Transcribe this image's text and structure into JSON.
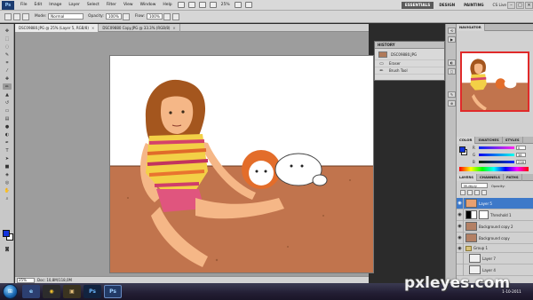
{
  "menubar": {
    "app_logo": "Ps",
    "items": [
      "File",
      "Edit",
      "Image",
      "Layer",
      "Select",
      "Filter",
      "View",
      "Window",
      "Help"
    ],
    "zoom": "25%",
    "workspaces": [
      "ESSENTIALS",
      "DESIGN",
      "PAINTING"
    ],
    "cs_live": "CS Live",
    "window_buttons": [
      "–",
      "□",
      "×"
    ]
  },
  "options": {
    "mode_label": "Mode:",
    "mode_value": "Normal",
    "opacity_label": "Opacity:",
    "opacity_value": "100%",
    "flow_label": "Flow:",
    "flow_value": "100%"
  },
  "tabs": [
    {
      "label": "DSC09880.JPG @ 25% (Layer 5, RGB/8)",
      "close": "×"
    },
    {
      "label": "DSC09880 Copy.JPG @ 33.3% (RGB/8)",
      "close": "×"
    }
  ],
  "status": {
    "zoom": "25%",
    "doc": "Doc: 10,8M/118,0M"
  },
  "history": {
    "title": "HISTORY",
    "snapshot": "DSC09880.JPG",
    "items": [
      "Eraser",
      "Brush Tool"
    ]
  },
  "navigator": {
    "title": "NAVIGATOR"
  },
  "color": {
    "tabs": [
      "COLOR",
      "SWATCHES",
      "STYLES"
    ],
    "channels": [
      {
        "label": "R",
        "value": "0"
      },
      {
        "label": "G",
        "value": "38"
      },
      {
        "label": "B",
        "value": "238"
      }
    ]
  },
  "layers": {
    "tabs": [
      "LAYERS",
      "CHANNELS",
      "PATHS"
    ],
    "blend": "Multiply",
    "opacity_label": "Opacity:",
    "items": [
      {
        "name": "Layer 5"
      },
      {
        "name": "Threshold 1"
      },
      {
        "name": "Background copy 2"
      },
      {
        "name": "Background copy"
      },
      {
        "name": "Group 1"
      },
      {
        "name": "Layer 7"
      },
      {
        "name": "Layer 4"
      }
    ]
  },
  "taskbar": {
    "start": "⊞",
    "apps": [
      "e",
      "◉",
      "▣",
      "Ps",
      "Ps"
    ],
    "time": "",
    "date": "1-10-2011"
  },
  "watermark": "pxleyes.com"
}
